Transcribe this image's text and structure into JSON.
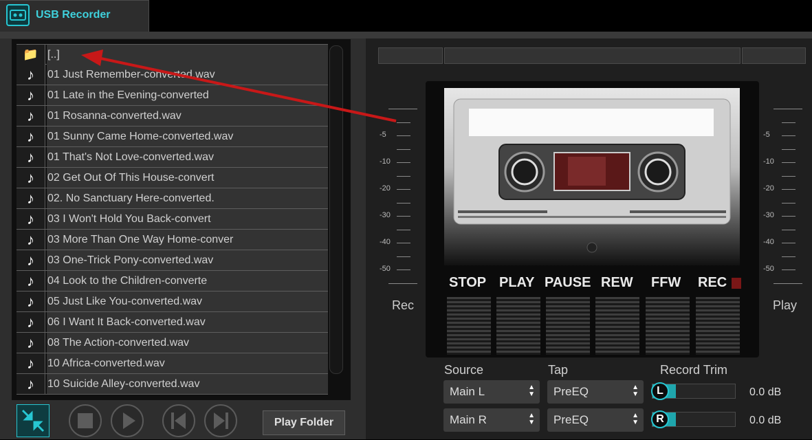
{
  "app": {
    "title": "USB Recorder",
    "accent_color": "#27c6d2"
  },
  "file_list": {
    "items": [
      {
        "icon": "folder-icon",
        "label": "[..]"
      },
      {
        "icon": "music-note-icon",
        "label": "01 Just Remember-converted.wav"
      },
      {
        "icon": "music-note-icon",
        "label": "01 Late in the Evening-converted"
      },
      {
        "icon": "music-note-icon",
        "label": "01 Rosanna-converted.wav"
      },
      {
        "icon": "music-note-icon",
        "label": "01 Sunny Came Home-converted.wav"
      },
      {
        "icon": "music-note-icon",
        "label": "01 That's Not Love-converted.wav"
      },
      {
        "icon": "music-note-icon",
        "label": "02 Get Out Of This House-convert"
      },
      {
        "icon": "music-note-icon",
        "label": "02. No Sanctuary Here-converted."
      },
      {
        "icon": "music-note-icon",
        "label": "03 I Won't Hold You Back-convert"
      },
      {
        "icon": "music-note-icon",
        "label": "03 More Than One Way Home-conver"
      },
      {
        "icon": "music-note-icon",
        "label": "03 One-Trick Pony-converted.wav"
      },
      {
        "icon": "music-note-icon",
        "label": "04 Look to the Children-converte"
      },
      {
        "icon": "music-note-icon",
        "label": "05 Just Like You-converted.wav"
      },
      {
        "icon": "music-note-icon",
        "label": "06 I Want It Back-converted.wav"
      },
      {
        "icon": "music-note-icon",
        "label": "08 The Action-converted.wav"
      },
      {
        "icon": "music-note-icon",
        "label": "10 Africa-converted.wav"
      },
      {
        "icon": "music-note-icon",
        "label": "10 Suicide Alley-converted.wav"
      }
    ]
  },
  "controls": {
    "play_folder_label": "Play Folder"
  },
  "transport": {
    "stop": "STOP",
    "play": "PLAY",
    "pause": "PAUSE",
    "rew": "REW",
    "ffw": "FFW",
    "rec": "REC"
  },
  "meters": {
    "rec_label": "Rec",
    "play_label": "Play",
    "scale": [
      "-5",
      "-10",
      "-20",
      "-30",
      "-40",
      "-50"
    ]
  },
  "routing": {
    "source_label": "Source",
    "tap_label": "Tap",
    "trim_label": "Record Trim",
    "rows": [
      {
        "channel": "L",
        "source": "Main L",
        "tap": "PreEQ",
        "trim_db": "0.0 dB",
        "trim_level": 0.28
      },
      {
        "channel": "R",
        "source": "Main R",
        "tap": "PreEQ",
        "trim_db": "0.0 dB",
        "trim_level": 0.28
      }
    ]
  }
}
